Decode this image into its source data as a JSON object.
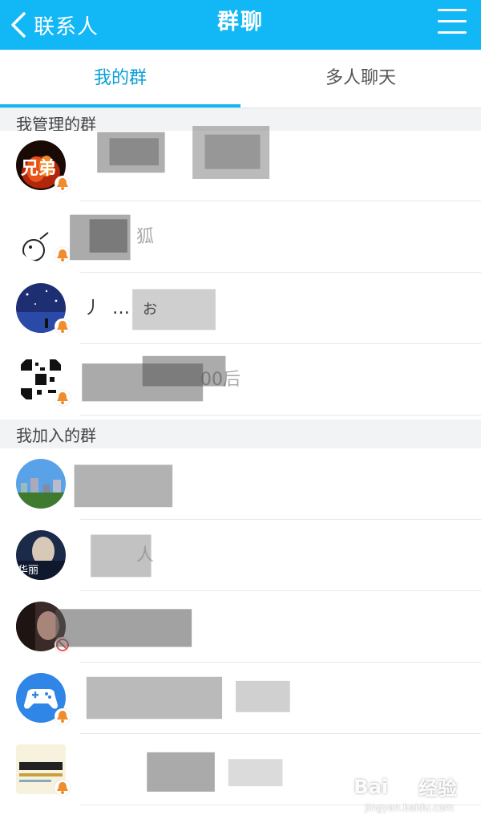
{
  "header": {
    "back_label": "联系人",
    "title": "群聊",
    "accent_color": "#12b7f5"
  },
  "tabs": [
    {
      "label": "我的群",
      "active": true
    },
    {
      "label": "多人聊天",
      "active": false
    }
  ],
  "sections": {
    "managed": {
      "label": "我管理的群",
      "groups": [
        {
          "name_fragment": "",
          "avatar": "fire-avatar",
          "badge": "bell-muted-icon"
        },
        {
          "name_fragment": "狐",
          "avatar": "sketch-bird-avatar",
          "badge": "bell-muted-icon"
        },
        {
          "name_fragment": "丿…ぉ",
          "avatar": "night-sky-avatar",
          "badge": "bell-muted-icon"
        },
        {
          "name_fragment": "00后",
          "avatar": "qr-code-avatar",
          "badge": "bell-muted-icon"
        }
      ]
    },
    "joined": {
      "label": "我加入的群",
      "groups": [
        {
          "name_fragment": "",
          "avatar": "city-skyline-avatar",
          "badge": ""
        },
        {
          "name_fragment": "人",
          "avatar": "portrait-avatar",
          "badge": ""
        },
        {
          "name_fragment": "",
          "avatar": "girl-portrait-avatar",
          "badge": "no-disturb-icon"
        },
        {
          "name_fragment": "",
          "avatar": "gamepad-avatar",
          "badge": "bell-muted-icon"
        },
        {
          "name_fragment": "",
          "avatar": "ticket-avatar",
          "badge": "bell-muted-icon"
        }
      ]
    }
  },
  "watermark": {
    "brand": "Bai",
    "brand_suffix": "经验",
    "url": "jingyan.baidu.com"
  }
}
